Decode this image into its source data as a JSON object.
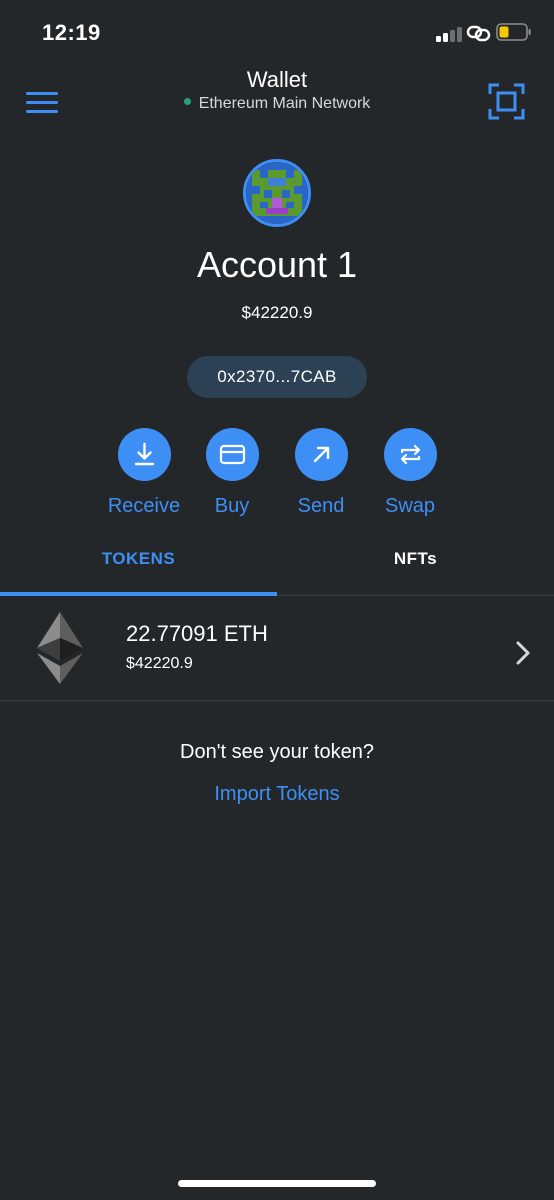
{
  "status_bar": {
    "time": "12:19",
    "icons": [
      "signal-icon",
      "link-icon",
      "battery-icon"
    ]
  },
  "header": {
    "title": "Wallet",
    "network": "Ethereum Main Network",
    "network_status_color": "#28a37b",
    "left_icon": "hamburger-menu-icon",
    "right_icon": "qr-scan-icon"
  },
  "account": {
    "name": "Account 1",
    "balance": "$42220.9",
    "address": "0x2370...7CAB"
  },
  "actions": [
    {
      "label": "Receive",
      "icon": "download-icon"
    },
    {
      "label": "Buy",
      "icon": "card-icon"
    },
    {
      "label": "Send",
      "icon": "arrow-up-right-icon"
    },
    {
      "label": "Swap",
      "icon": "swap-arrows-icon"
    }
  ],
  "tabs": [
    {
      "label": "TOKENS",
      "active": true
    },
    {
      "label": "NFTs",
      "active": false
    }
  ],
  "tokens": [
    {
      "amount": "22.77091 ETH",
      "fiat": "$42220.9",
      "icon": "ethereum-icon"
    }
  ],
  "footer": {
    "prompt": "Don't see your token?",
    "link": "Import Tokens"
  },
  "colors": {
    "background": "#24272a",
    "accent": "#3e8ff5",
    "address_pill": "#2d4154",
    "divider": "#3a3d41"
  }
}
